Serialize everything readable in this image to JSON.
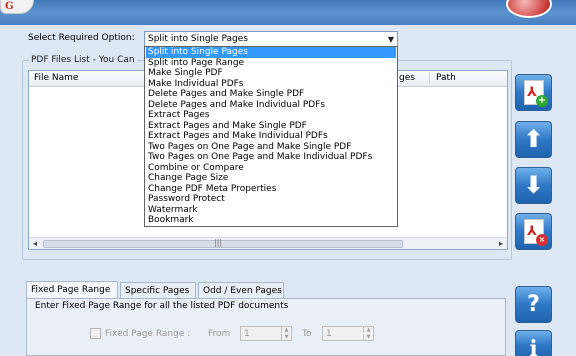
{
  "header": {
    "select_label": "Select Required Option:",
    "selected_option": "Split into Single Pages"
  },
  "dropdown": {
    "options": [
      "Split into Single Pages",
      "Split into Page Range",
      "Make Single PDF",
      "Make Individual PDFs",
      "Delete Pages and Make Single PDF",
      "Delete Pages and Make Individual PDFs",
      "Extract Pages",
      "Extract Pages and Make Single PDF",
      "Extract Pages and Make Individual PDFs",
      "Two Pages on One Page and Make Single PDF",
      "Two Pages on One Page and Make Individual PDFs",
      "Combine or Compare",
      "Change Page Size",
      "Change PDF Meta Properties",
      "Password Protect",
      "Watermark",
      "Bookmark"
    ],
    "selected_index": 0
  },
  "file_list": {
    "group_title": "PDF Files List - You Can",
    "columns": [
      "File Name",
      "ges",
      "Path"
    ],
    "scroll_left": "◂",
    "scroll_right": "▸",
    "scroll_grip": "|||"
  },
  "side_buttons": {
    "add_badge": "+",
    "up_arrow": "⬆",
    "down_arrow": "⬇",
    "remove_badge": "×",
    "help": "?",
    "info": "i",
    "pdf_mark": "⅄"
  },
  "tabs": [
    "Fixed Page Range",
    "Specific Pages",
    "Odd / Even Pages"
  ],
  "fixed_range": {
    "group_title": "Enter Fixed Page Range for all the listed PDF documents",
    "checkbox_label": "Fixed Page Range :",
    "from_label": "From",
    "from_value": "1",
    "to_label": "To",
    "to_value": "1",
    "spin_up": "▲",
    "spin_down": "▼"
  },
  "logo": {
    "left_text": "G"
  },
  "colors": {
    "title_bar": "#4a80c0",
    "selection": "#3399ff",
    "side_button": "#2f78c6"
  }
}
